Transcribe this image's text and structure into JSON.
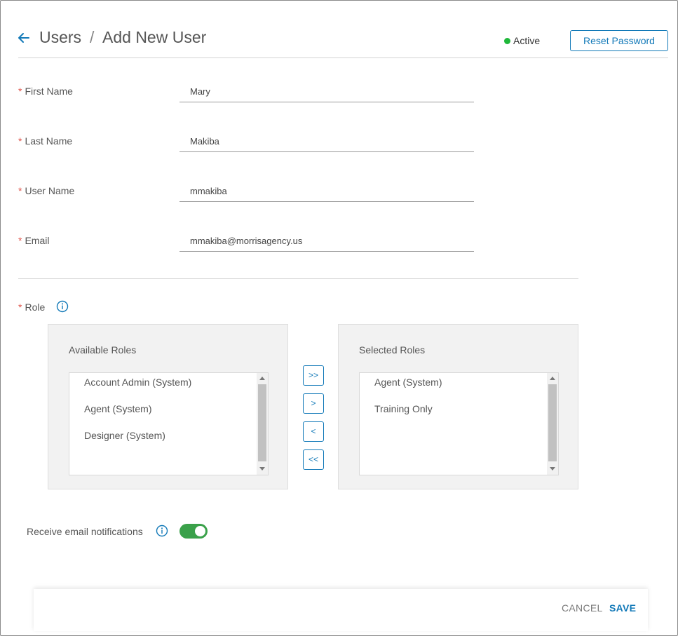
{
  "header": {
    "breadcrumb_root": "Users",
    "breadcrumb_separator": "/",
    "page_title": "Add New User",
    "status": "Active",
    "status_color": "#1fb83a",
    "reset_password_label": "Reset Password",
    "back_icon": "back-arrow-icon"
  },
  "form": {
    "required_marker": "*",
    "first_name": {
      "label": "First Name",
      "value": "Mary"
    },
    "last_name": {
      "label": "Last Name",
      "value": "Makiba"
    },
    "user_name": {
      "label": "User Name",
      "value": "mmakiba"
    },
    "email": {
      "label": "Email",
      "value": "mmakiba@morrisagency.us"
    }
  },
  "roles": {
    "label": "Role",
    "info_icon": "info-icon",
    "available_title": "Available Roles",
    "available": [
      "Account Admin (System)",
      "Agent (System)",
      "Designer (System)"
    ],
    "selected_title": "Selected Roles",
    "selected": [
      "Agent (System)",
      "Training Only"
    ],
    "move_all_right": ">>",
    "move_right": ">",
    "move_left": "<",
    "move_all_left": "<<"
  },
  "notifications": {
    "label": "Receive email notifications",
    "enabled": true,
    "toggle_color": "#3aa14a"
  },
  "footer": {
    "cancel_label": "CANCEL",
    "save_label": "SAVE"
  },
  "colors": {
    "accent": "#1279b8",
    "required": "#e0554c"
  }
}
